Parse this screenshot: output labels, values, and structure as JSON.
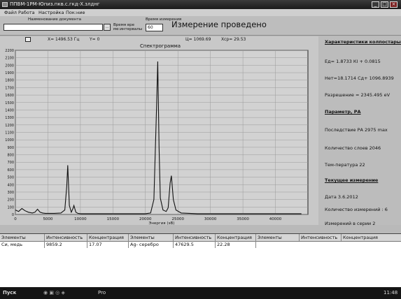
{
  "window": {
    "title": "ППВМ-1РМ-Юпиз.пкв.с.гкд-Х.злднг",
    "btn_min": "_",
    "btn_max": "□",
    "btn_close": "×"
  },
  "menu": {
    "items": [
      "Файл",
      "Работа",
      "Настройка",
      "Пок:ние"
    ]
  },
  "toolbar": {
    "name_label": "Наименование документа",
    "name_value": "",
    "browse_label": "...",
    "exposure_label": "Время вре ме:интервалы",
    "time_label": "Время измерения",
    "time_value": "60",
    "status": "Измерение проведено"
  },
  "chart_info": {
    "checkbox_label": "",
    "x_readout": "X= 1496.53 Гц",
    "y_readout": "Y= 0",
    "title": "Спектрограмма",
    "marker_readout": "Ц= 1069.69",
    "range_readout": "Xср= 29.53"
  },
  "side_panel": {
    "calib_header": "Характеристики колпостарых",
    "calib_1": "Ед= 1.8733 КI + 0.0815",
    "calib_2": "Нет=18.1714 Сд+ 1096.8939",
    "calib_3": "Разрешение = 2345.495 eV",
    "params_header": "Параметр, РА",
    "param_1": "Последствие РА 2975 max",
    "param_2": "Количество слоев 2046",
    "param_3": "Тем-пература 22",
    "date_header": "Текущее измерение",
    "date_line": "Дата    3.6.2012",
    "count_line": "Количество измерений : 6",
    "series_line": "Измерений в серии 2"
  },
  "table": {
    "headers": [
      "Элементы",
      "Интенсивность",
      "Концентрация",
      "Элементы",
      "Интенсивность",
      "Концентрация",
      "Элементы",
      "Интенсивность",
      "Концентрация"
    ],
    "rows": [
      [
        "Си, медь",
        "9859.2",
        "17.07",
        "Ag- серебро",
        "47629.5",
        "22.28",
        "",
        "",
        ""
      ]
    ]
  },
  "taskbar": {
    "start": "Пуск",
    "window_btn": "Pro",
    "clock": "11:48"
  },
  "chart_data": {
    "type": "line",
    "title": "Спектрограмма",
    "xlabel": "Энергия (эВ)",
    "ylabel": "",
    "xlim": [
      0,
      45000
    ],
    "ylim": [
      0,
      2200
    ],
    "x_ticks": [
      0,
      5000,
      10000,
      15000,
      20000,
      25000,
      30000,
      35000,
      40000
    ],
    "y_ticks": [
      0,
      100,
      200,
      300,
      400,
      500,
      600,
      700,
      800,
      900,
      1000,
      1100,
      1200,
      1300,
      1400,
      1500,
      1600,
      1700,
      1800,
      1900,
      2000,
      2100,
      2200
    ],
    "series": [
      {
        "x": [
          0,
          500,
          1000,
          1500,
          2000,
          2600,
          3000,
          3400,
          3800,
          4200,
          4600,
          5000,
          6000,
          7000,
          7600,
          7900,
          8050,
          8300,
          8600,
          8900,
          9000,
          9300,
          9600,
          10000,
          12000,
          14000,
          16000,
          18000,
          20000,
          20800,
          21300,
          21700,
          21900,
          22100,
          22300,
          22700,
          23200,
          23500,
          23800,
          24000,
          24300,
          24700,
          25500,
          28000,
          32000,
          36000,
          40000,
          44000
        ],
        "y": [
          60,
          40,
          80,
          50,
          30,
          20,
          30,
          70,
          30,
          20,
          15,
          15,
          15,
          20,
          60,
          380,
          660,
          120,
          30,
          90,
          120,
          30,
          15,
          10,
          10,
          10,
          10,
          10,
          10,
          20,
          200,
          1400,
          2050,
          900,
          220,
          60,
          40,
          90,
          420,
          520,
          200,
          60,
          20,
          10,
          10,
          10,
          10,
          10
        ]
      }
    ]
  }
}
